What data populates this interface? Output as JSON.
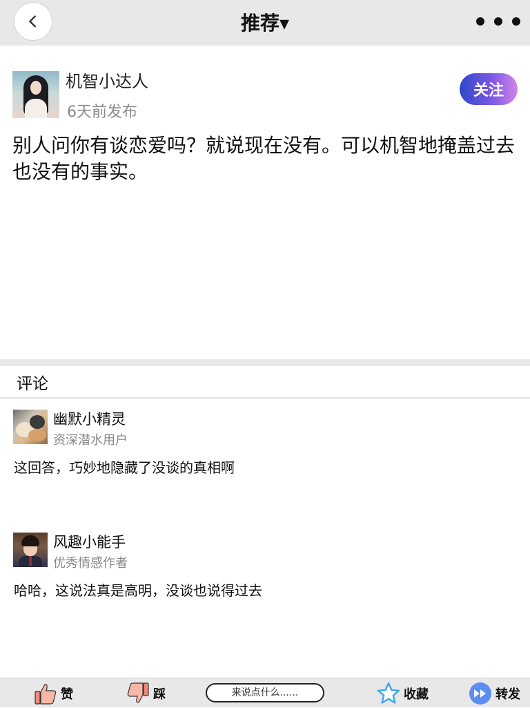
{
  "header": {
    "title": "推荐▾",
    "back_icon": "chevron-left-icon",
    "more_icon": "more-dots-icon"
  },
  "post": {
    "author": "机智小达人",
    "time": "6天前发布",
    "follow_label": "关注",
    "body": "别人问你有谈恋爱吗？就说现在没有。可以机智地掩盖过去也没有的事实。"
  },
  "comments_section": {
    "title": "评论",
    "items": [
      {
        "name": "幽默小精灵",
        "title": "资深潜水用户",
        "text": "这回答，巧妙地隐藏了没谈的真相啊"
      },
      {
        "name": "风趣小能手",
        "title": "优秀情感作者",
        "text": "哈哈，这说法真是高明，没谈也说得过去"
      }
    ]
  },
  "bottom_bar": {
    "like_label": "赞",
    "dislike_label": "踩",
    "comment_placeholder": "来说点什么......",
    "favorite_label": "收藏",
    "share_label": "转发"
  },
  "colors": {
    "follow_gradient_start": "#2f47c8",
    "follow_gradient_end": "#d186e6",
    "thumb_color": "#f08a78",
    "star_color": "#3aa8f0",
    "share_color": "#5b8ef0",
    "bar_background": "#e8e8e8"
  }
}
